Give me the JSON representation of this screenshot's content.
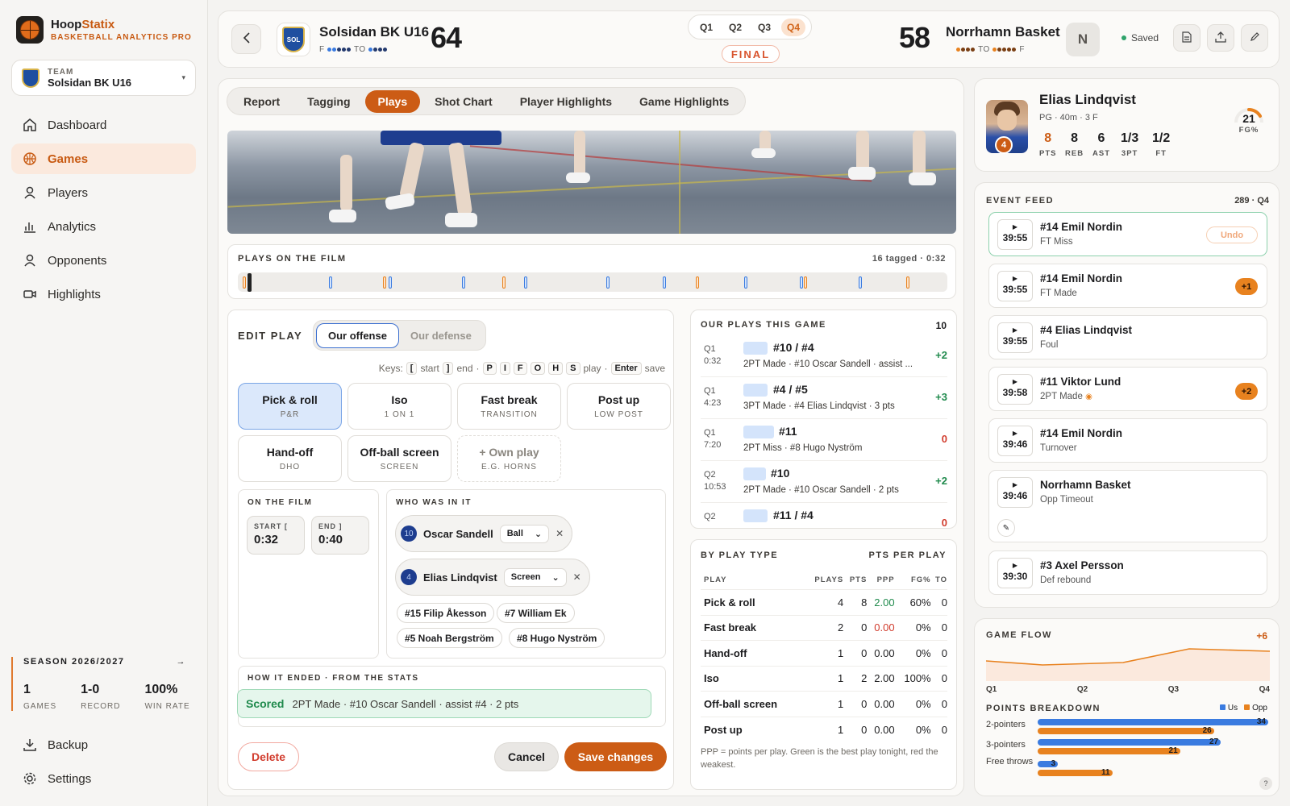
{
  "app": {
    "name_a": "Hoop",
    "name_b": "Statix",
    "subtitle": "BASKETBALL ANALYTICS PRO"
  },
  "team": {
    "label": "TEAM",
    "name": "Solsidan BK U16"
  },
  "nav": [
    {
      "label": "Dashboard",
      "icon": "home-icon"
    },
    {
      "label": "Games",
      "icon": "basketball-icon"
    },
    {
      "label": "Players",
      "icon": "user-icon"
    },
    {
      "label": "Analytics",
      "icon": "bar-chart-icon"
    },
    {
      "label": "Opponents",
      "icon": "user-icon"
    },
    {
      "label": "Highlights",
      "icon": "video-icon"
    }
  ],
  "season": {
    "title": "SEASON 2026/2027",
    "games": "1",
    "games_label": "GAMES",
    "record": "1-0",
    "record_label": "RECORD",
    "win_rate": "100%",
    "win_rate_label": "WIN RATE"
  },
  "bottom_nav": [
    {
      "label": "Backup",
      "icon": "download-icon"
    },
    {
      "label": "Settings",
      "icon": "gear-icon"
    }
  ],
  "header": {
    "home_name": "Solsidan BK U16",
    "home_badge": "SOL",
    "home_score": "64",
    "home_fouls": "F",
    "home_to": "TO",
    "quarters": [
      "Q1",
      "Q2",
      "Q3",
      "Q4"
    ],
    "status": "FINAL",
    "away_score": "58",
    "away_name": "Norrhamn Basket",
    "away_badge": "N",
    "away_to": "TO",
    "away_fouls": "F",
    "saved": "Saved"
  },
  "tabs": [
    "Report",
    "Tagging",
    "Plays",
    "Shot Chart",
    "Player Highlights",
    "Game Highlights"
  ],
  "plays_film": {
    "title": "PLAYS ON THE FILM",
    "summary": "16 tagged · 0:32"
  },
  "edit": {
    "title": "EDIT PLAY",
    "offense": "Our offense",
    "defense": "Our defense",
    "keys_label": "Keys:",
    "keys": [
      "[",
      "start",
      "]",
      "end",
      "·",
      "P",
      "I",
      "F",
      "O",
      "H",
      "S",
      "play",
      "·",
      "Enter",
      "save"
    ],
    "types": [
      {
        "name": "Pick & roll",
        "sub": "P&R"
      },
      {
        "name": "Iso",
        "sub": "1 ON 1"
      },
      {
        "name": "Fast break",
        "sub": "TRANSITION"
      },
      {
        "name": "Post up",
        "sub": "LOW POST"
      },
      {
        "name": "Hand-off",
        "sub": "DHO"
      },
      {
        "name": "Off-ball screen",
        "sub": "SCREEN"
      },
      {
        "name": "+ Own play",
        "sub": "E.G. HORNS"
      }
    ],
    "film_title": "ON THE FILM",
    "start_label": "START [",
    "start": "0:32",
    "end_label": "END ]",
    "end": "0:40",
    "who_title": "WHO WAS IN IT",
    "players": [
      {
        "num": "10",
        "name": "Oscar Sandell",
        "role": "Ball"
      },
      {
        "num": "4",
        "name": "Elias Lindqvist",
        "role": "Screen"
      }
    ],
    "others": [
      "#15 Filip Åkesson",
      "#7 William Ek",
      "#5 Noah Bergström",
      "#8 Hugo Nyström"
    ],
    "ended_title": "HOW IT ENDED · FROM THE STATS",
    "ended_tag": "Scored",
    "ended_desc": "2PT Made · #10 Oscar Sandell · assist #4 · 2 pts",
    "delete": "Delete",
    "cancel": "Cancel",
    "save": "Save changes"
  },
  "our_plays": {
    "title": "OUR PLAYS THIS GAME",
    "count": "10",
    "rows": [
      {
        "q": "Q1",
        "t": "0:32",
        "title": "#10 / #4",
        "desc": "2PT Made · #10 Oscar Sandell · assist ...",
        "pts": "+2"
      },
      {
        "q": "Q1",
        "t": "4:23",
        "title": "#4 / #5",
        "desc": "3PT Made · #4 Elias Lindqvist · 3 pts",
        "pts": "+3"
      },
      {
        "q": "Q1",
        "t": "7:20",
        "title": "#11",
        "desc": "2PT Miss · #8 Hugo Nyström",
        "pts": "0"
      },
      {
        "q": "Q2",
        "t": "10:53",
        "title": "#10",
        "desc": "2PT Made · #10 Oscar Sandell · 2 pts",
        "pts": "+2"
      },
      {
        "q": "Q2",
        "t": "",
        "title": "#11 / #4",
        "desc": "",
        "pts": "0"
      }
    ]
  },
  "by_type": {
    "title": "BY PLAY TYPE",
    "subtitle": "PTS PER PLAY",
    "cols": [
      "PLAY",
      "PLAYS",
      "PTS",
      "PPP",
      "FG%",
      "TO"
    ],
    "rows": [
      [
        "Pick & roll",
        "4",
        "8",
        "2.00",
        "60%",
        "0"
      ],
      [
        "Fast break",
        "2",
        "0",
        "0.00",
        "0%",
        "0"
      ],
      [
        "Hand-off",
        "1",
        "0",
        "0.00",
        "0%",
        "0"
      ],
      [
        "Iso",
        "1",
        "2",
        "2.00",
        "100%",
        "0"
      ],
      [
        "Off-ball screen",
        "1",
        "0",
        "0.00",
        "0%",
        "0"
      ],
      [
        "Post up",
        "1",
        "0",
        "0.00",
        "0%",
        "0"
      ]
    ],
    "note": "PPP = points per play. Green is the best play tonight, red the weakest."
  },
  "player": {
    "name": "Elias Lindqvist",
    "meta": "PG · 40m · 3 F",
    "num": "4",
    "stats": [
      {
        "v": "8",
        "l": "PTS"
      },
      {
        "v": "8",
        "l": "REB"
      },
      {
        "v": "6",
        "l": "AST"
      },
      {
        "v": "1/3",
        "l": "3PT"
      },
      {
        "v": "1/2",
        "l": "FT"
      }
    ],
    "fg": "21",
    "fg_label": "FG%"
  },
  "feed": {
    "title": "EVENT FEED",
    "count": "289 · Q4",
    "events": [
      {
        "time": "39:55",
        "title": "#14 Emil Nordin",
        "sub": "FT Miss",
        "pill": "Undo"
      },
      {
        "time": "39:55",
        "title": "#14 Emil Nordin",
        "sub": "FT Made",
        "pill": "+1"
      },
      {
        "time": "39:55",
        "title": "#4 Elias Lindqvist",
        "sub": "Foul",
        "pill": ""
      },
      {
        "time": "39:58",
        "title": "#11 Viktor Lund",
        "sub": "2PT Made",
        "pill": "+2"
      },
      {
        "time": "39:46",
        "title": "#14 Emil Nordin",
        "sub": "Turnover",
        "pill": ""
      },
      {
        "time": "39:46",
        "title": "Norrhamn Basket",
        "sub": "Opp Timeout",
        "pill": ""
      },
      {
        "time": "39:30",
        "title": "#3 Axel Persson",
        "sub": "Def rebound",
        "pill": ""
      }
    ]
  },
  "flow": {
    "title": "GAME FLOW",
    "diff": "+6",
    "quarters": [
      "Q1",
      "Q2",
      "Q3",
      "Q4"
    ],
    "breakdown_title": "POINTS BREAKDOWN",
    "legend_us": "Us",
    "legend_opp": "Opp"
  },
  "chart_data": {
    "type": "bar",
    "title": "POINTS BREAKDOWN",
    "categories": [
      "2-pointers",
      "3-pointers",
      "Free throws"
    ],
    "series": [
      {
        "name": "Us",
        "values": [
          34,
          27,
          3
        ]
      },
      {
        "name": "Opp",
        "values": [
          26,
          21,
          11
        ]
      }
    ],
    "xlim": [
      0,
      34
    ],
    "colors": {
      "Us": "#3a7be0",
      "Opp": "#e8821f"
    }
  },
  "colors": {
    "accent": "#cc5c15",
    "blue": "#3a7be0",
    "green": "#1f8a4c",
    "red": "#d13b2c"
  }
}
